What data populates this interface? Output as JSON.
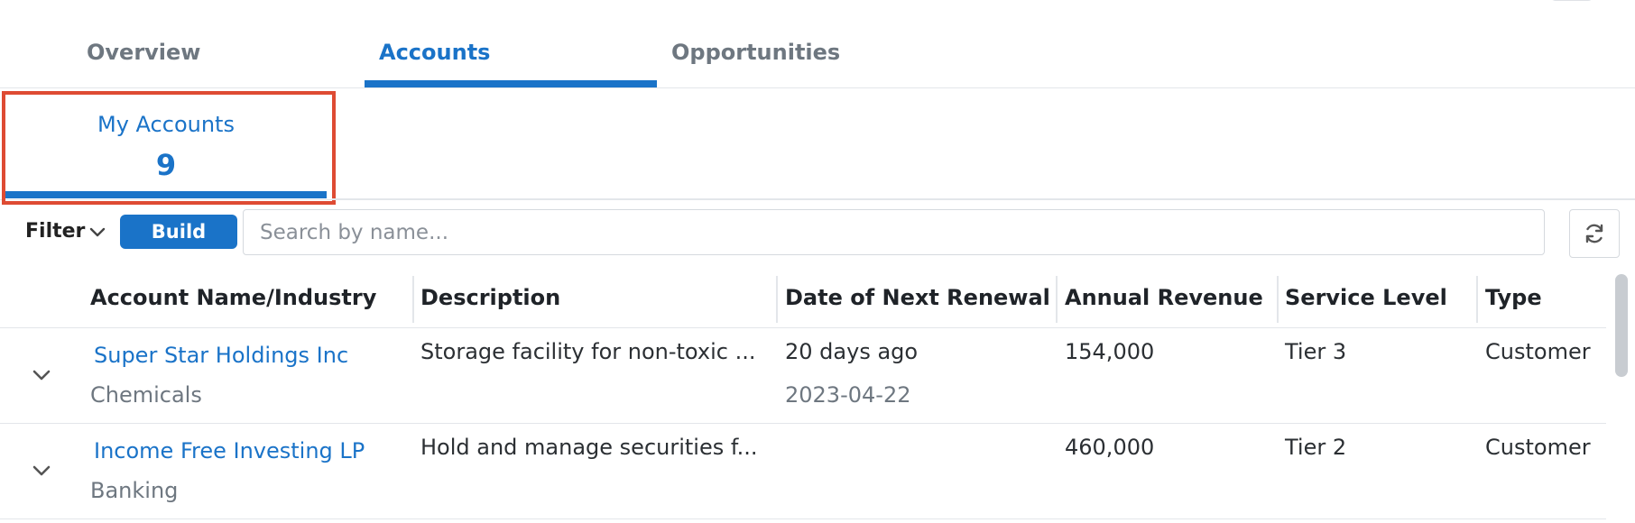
{
  "tabs": [
    {
      "label": "Overview"
    },
    {
      "label": "Accounts"
    },
    {
      "label": "Opportunities"
    }
  ],
  "subtab": {
    "label": "My Accounts",
    "count": "9"
  },
  "filter": {
    "label": "Filter",
    "build_label": "Build Filter",
    "search_placeholder": "Search by name..."
  },
  "table": {
    "columns": [
      "Account Name/Industry",
      "Description",
      "Date of Next Renewal",
      "Annual Revenue",
      "Service Level",
      "Type"
    ],
    "rows": [
      {
        "name": "Super Star Holdings Inc",
        "industry": "Chemicals",
        "description": "Storage facility for non-toxic ...",
        "renewal_relative": "20 days ago",
        "renewal_date": "2023-04-22",
        "revenue": "154,000",
        "service_level": "Tier 3",
        "type": "Customer"
      },
      {
        "name": "Income Free Investing LP",
        "industry": "Banking",
        "description": "Hold and manage securities f...",
        "renewal_relative": "",
        "renewal_date": "",
        "revenue": "460,000",
        "service_level": "Tier 2",
        "type": "Customer"
      }
    ]
  },
  "colors": {
    "accent": "#1a73c8",
    "highlight": "#de4b33"
  },
  "icons": {
    "filter_toggle": "chevron-down-icon",
    "refresh": "refresh-icon",
    "row_expand": "chevron-down-icon"
  }
}
